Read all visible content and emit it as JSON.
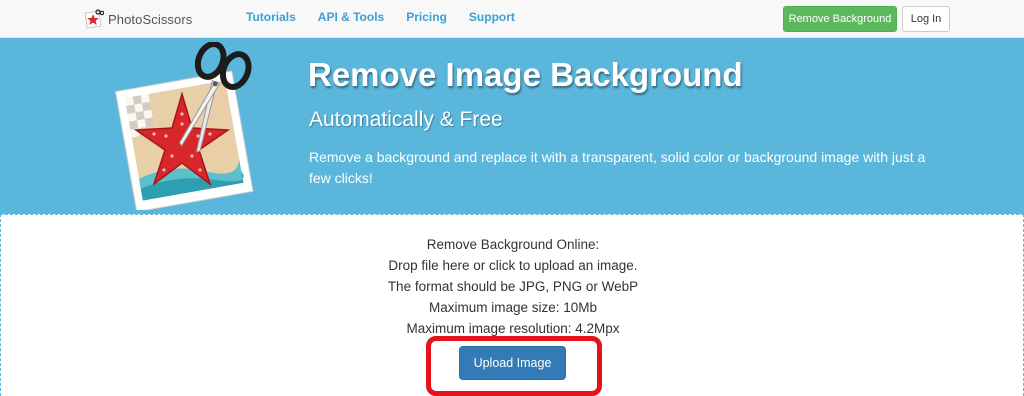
{
  "navbar": {
    "brand_name": "PhotoScissors",
    "brand_icon": "scissors-star-logo-icon",
    "links": [
      "Tutorials",
      "API & Tools",
      "Pricing",
      "Support"
    ],
    "remove_bg_label": "Remove Background",
    "login_label": "Log In",
    "colors": {
      "link": "#3d9fd3",
      "remove_bg_button": "#5cb85c"
    }
  },
  "hero": {
    "title": "Remove Image Background",
    "subtitle": "Automatically & Free",
    "description": "Remove a background and replace it with a transparent, solid color or background image with just a few clicks!",
    "illustration_icon": "starfish-photo-scissors-icon",
    "background_color": "#5ab7db"
  },
  "upload": {
    "lines": [
      "Remove Background Online:",
      "Drop file here or click to upload an image.",
      "The format should be JPG, PNG or WebP",
      "Maximum image size: 10Mb",
      "Maximum image resolution: 4.2Mpx"
    ],
    "button_label": "Upload Image",
    "highlight_color": "#e3121b",
    "button_color": "#337ab7"
  }
}
